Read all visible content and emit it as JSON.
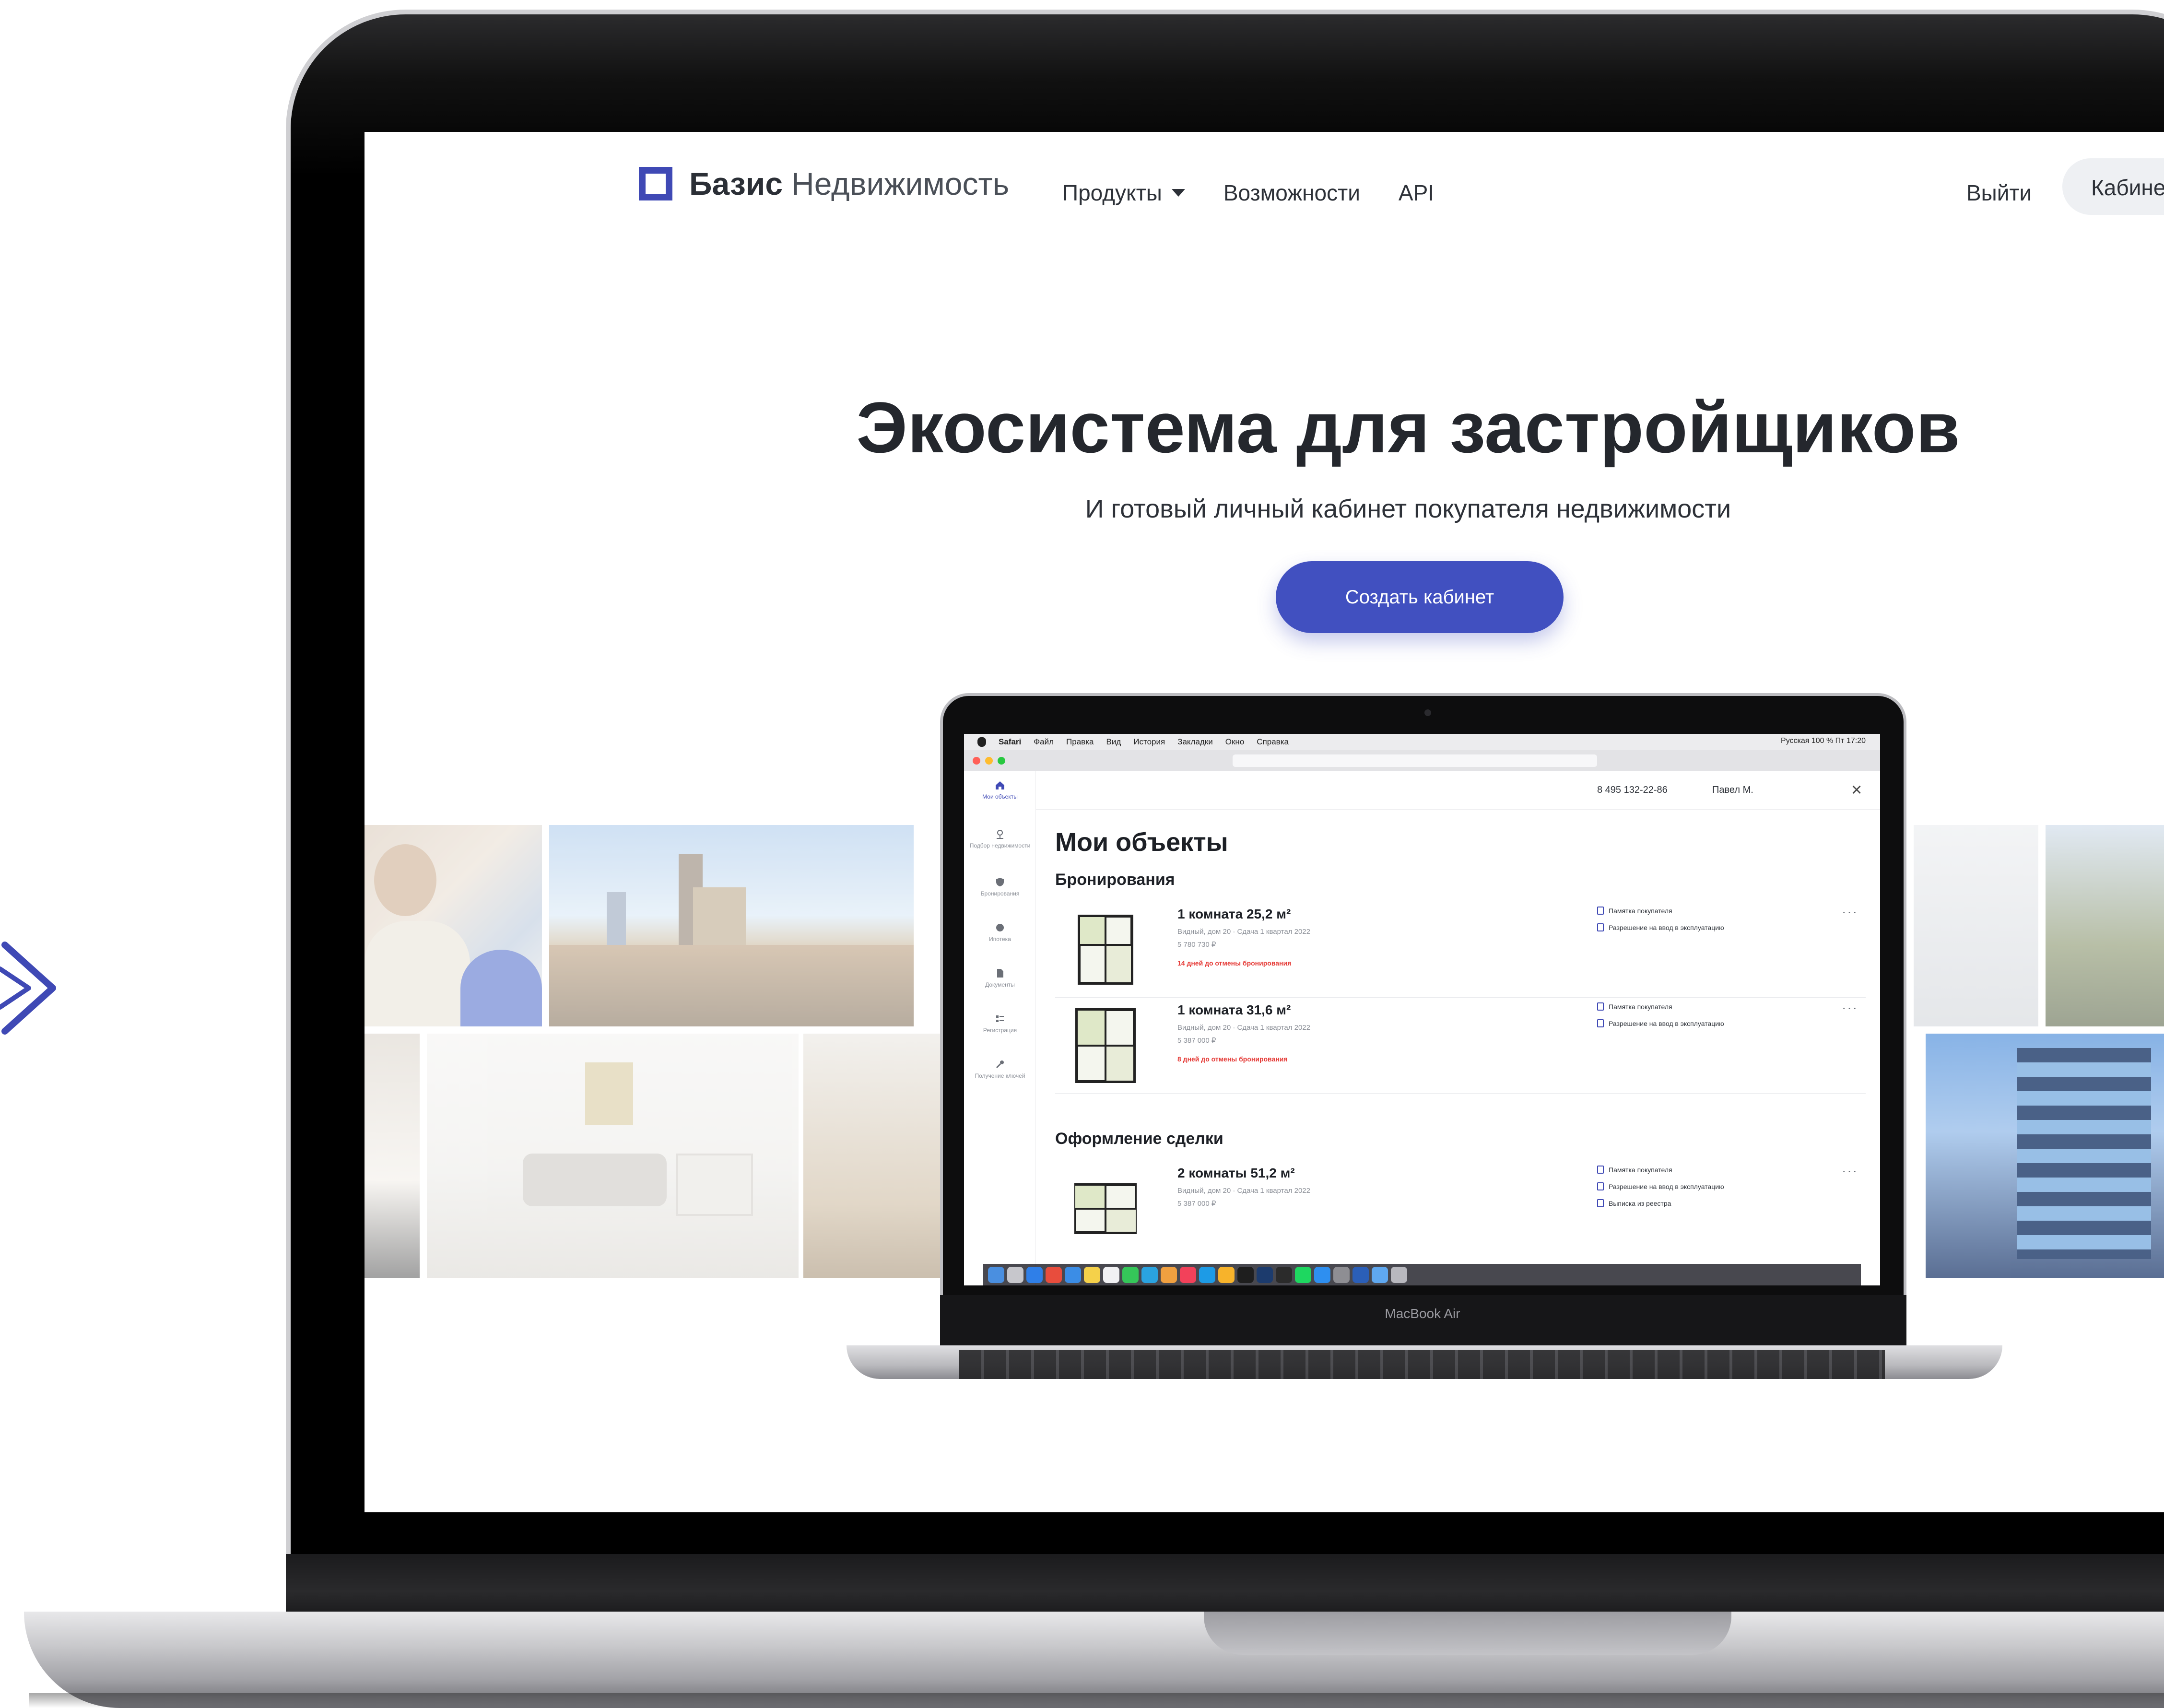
{
  "site": {
    "logo_bold": "Базис",
    "logo_light": "Недвижимость",
    "nav": {
      "products": "Продукты",
      "features": "Возможности",
      "api": "API",
      "logout": "Выйти",
      "cabinet": "Кабине"
    },
    "hero": {
      "title": "Экосистема для застройщиков",
      "subtitle": "И готовый личный кабинет покупателя недвижимости",
      "cta": "Создать кабинет"
    }
  },
  "inner_device": {
    "model_label": "MacBook Air",
    "mac_menu": [
      "Safari",
      "Файл",
      "Правка",
      "Вид",
      "История",
      "Закладки",
      "Окно",
      "Справка"
    ],
    "mac_status": "Русская   100 %   Пт 17:20",
    "app": {
      "phone": "8 495 132-22-86",
      "user": "Павел М.",
      "title": "Мои объекты",
      "sidebar": [
        {
          "label": "Мои объекты",
          "active": true
        },
        {
          "label": "Подбор недвижимости",
          "active": false
        },
        {
          "label": "Бронирования",
          "active": false
        },
        {
          "label": "Ипотека",
          "active": false
        },
        {
          "label": "Документы",
          "active": false
        },
        {
          "label": "Регистрация",
          "active": false
        },
        {
          "label": "Получение ключей",
          "active": false
        }
      ],
      "sections": {
        "bookings": "Бронирования",
        "deal": "Оформление сделки"
      },
      "objects": [
        {
          "name": "1 комната 25,2 м²",
          "meta": "Видный, дом 20  ·  Сдача 1 квартал 2022",
          "price": "5 780 730 ₽",
          "warning": "14 дней до отмены бронирования",
          "docs": [
            "Памятка покупателя",
            "Разрешение на ввод в эксплуатацию"
          ]
        },
        {
          "name": "1 комната 31,6 м²",
          "meta": "Видный, дом 20  ·  Сдача 1 квартал 2022",
          "price": "5 387 000 ₽",
          "warning": "8 дней до отмены бронирования",
          "docs": [
            "Памятка покупателя",
            "Разрешение на ввод в эксплуатацию"
          ]
        },
        {
          "name": "2 комнаты 51,2 м²",
          "meta": "Видный, дом 20  ·  Сдача 1 квартал 2022",
          "price": "5 387 000 ₽",
          "warning": "",
          "docs": [
            "Памятка покупателя",
            "Разрешение на ввод в эксплуатацию",
            "Выписка из реестра"
          ]
        }
      ],
      "more": "···"
    }
  },
  "colors": {
    "brand": "#3f49b5",
    "cta": "#4150c0",
    "warning": "#e53935",
    "text": "#24272d"
  }
}
